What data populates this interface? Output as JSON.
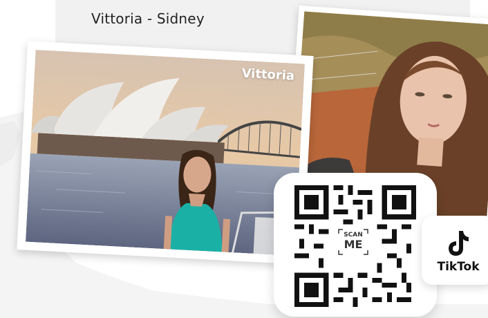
{
  "header": {
    "title": "Vittoria - Sidney"
  },
  "photos": {
    "left_label": "Vittoria"
  },
  "qr": {
    "scan_line1": "SCAN",
    "scan_line2": "ME"
  },
  "tiktok": {
    "label": "TikTok",
    "icon": "tiktok-icon"
  },
  "colors": {
    "header_bg": "#f1f1f1",
    "map_bg": "#f3f3f3",
    "qr_color": "#111111"
  }
}
